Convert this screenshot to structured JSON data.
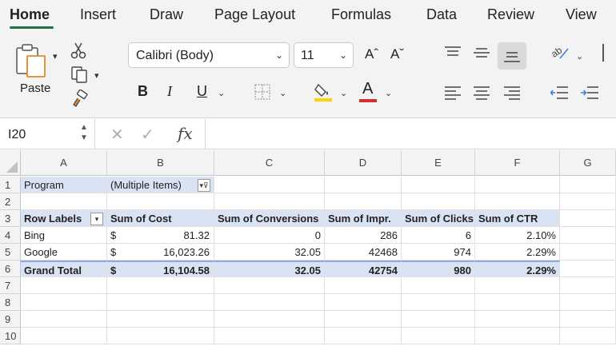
{
  "ribbon": {
    "tabs": [
      "Home",
      "Insert",
      "Draw",
      "Page Layout",
      "Formulas",
      "Data",
      "Review",
      "View"
    ],
    "active_tab": "Home",
    "paste_label": "Paste",
    "font_name": "Calibri (Body)",
    "font_size": "11",
    "bold": "B",
    "italic": "I",
    "underline": "U",
    "font_color_letter": "A",
    "grow_font": "Aˆ",
    "shrink_font": "Aˇ",
    "accent_color": "#1e7145",
    "highlight_color": "#ffd400",
    "font_color": "#d32f2f"
  },
  "formula_bar": {
    "name_box": "I20",
    "fx": "fx",
    "content": ""
  },
  "sheet": {
    "columns": [
      "A",
      "B",
      "C",
      "D",
      "E",
      "F",
      "G"
    ],
    "rows": [
      "1",
      "2",
      "3",
      "4",
      "5",
      "6",
      "7",
      "8",
      "9",
      "10"
    ],
    "filter": {
      "label": "Program",
      "value": "(Multiple Items)"
    },
    "pivot_headers": [
      "Row Labels",
      "Sum of Cost",
      "Sum of Conversions",
      "Sum of Impr.",
      "Sum of Clicks",
      "Sum of CTR"
    ],
    "pivot_rows": [
      {
        "label": "Bing",
        "currency": "$",
        "cost": "81.32",
        "conversions": "0",
        "impr": "286",
        "clicks": "6",
        "ctr": "2.10%"
      },
      {
        "label": "Google",
        "currency": "$",
        "cost": "16,023.26",
        "conversions": "32.05",
        "impr": "42468",
        "clicks": "974",
        "ctr": "2.29%"
      }
    ],
    "total_row": {
      "label": "Grand Total",
      "currency": "$",
      "cost": "16,104.58",
      "conversions": "32.05",
      "impr": "42754",
      "clicks": "980",
      "ctr": "2.29%"
    }
  }
}
